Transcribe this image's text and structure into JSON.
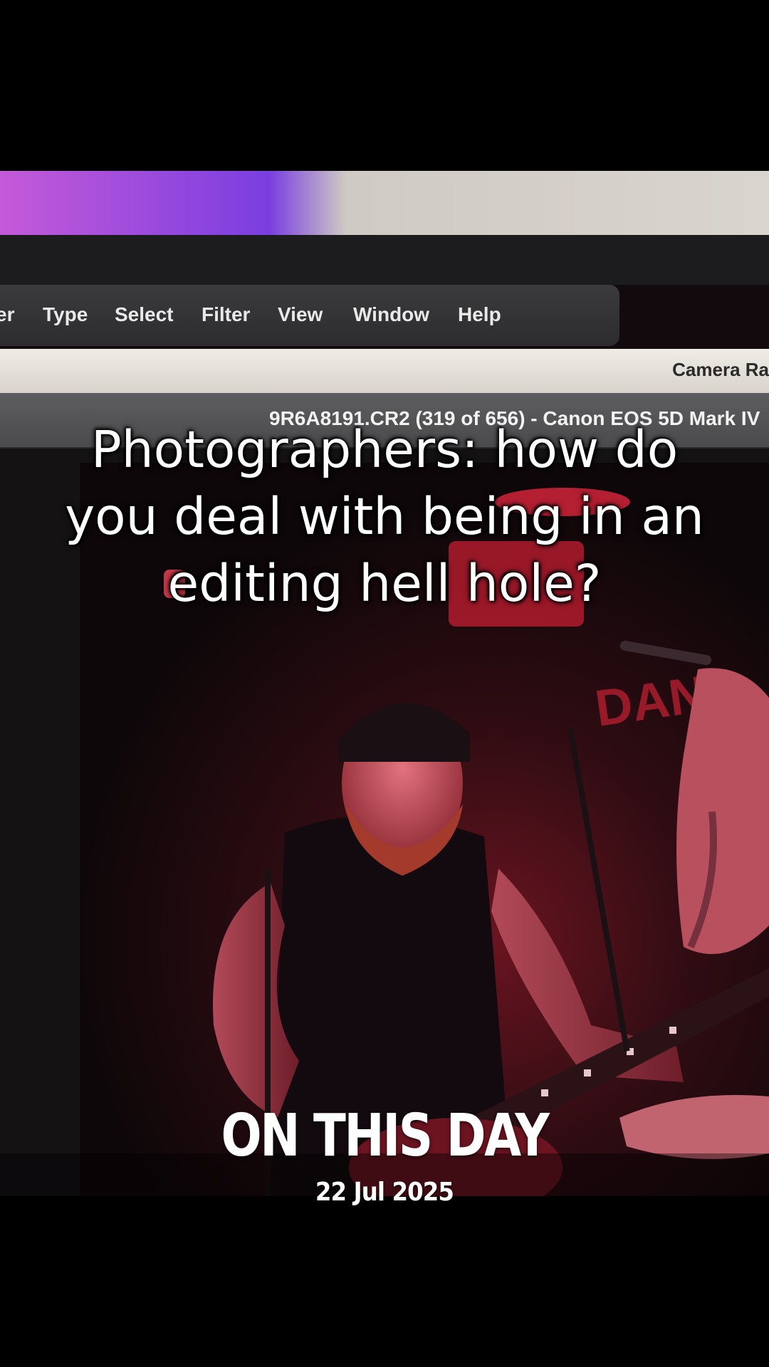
{
  "menubar": {
    "items": [
      "er",
      "Type",
      "Select",
      "Filter",
      "View",
      "Window",
      "Help"
    ]
  },
  "camera_raw": {
    "title": "Camera Ra"
  },
  "file_info": {
    "title": "9R6A8191.CR2 (319 of 656)  -  Canon EOS 5D Mark IV"
  },
  "overlay": {
    "caption_lines": [
      "Photographers: how do",
      "you deal with being in an",
      "editing hell hole?"
    ],
    "heading": "ON THIS DAY",
    "date": "22 Jul 2025"
  },
  "colors": {
    "stage_red": "#c81e2e",
    "menu_bg": "#333336",
    "camera_raw_bg": "#e6e3dc"
  }
}
